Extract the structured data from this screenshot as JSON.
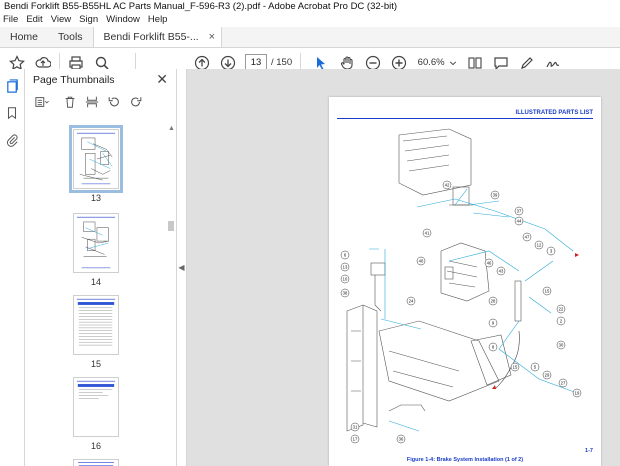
{
  "window": {
    "title": "Bendi Forklift B55-B55HL AC Parts Manual_F-596-R3 (2).pdf - Adobe Acrobat Pro DC (32-bit)"
  },
  "menu": [
    "File",
    "Edit",
    "View",
    "Sign",
    "Window",
    "Help"
  ],
  "tabs": {
    "home": "Home",
    "tools": "Tools",
    "doc": "Bendi Forklift B55-...",
    "close": "×"
  },
  "toolbar": {
    "page_current": "13",
    "page_total": "/ 150",
    "zoom": "60.6%"
  },
  "panel": {
    "title": "Page Thumbnails",
    "close": "✕",
    "thumbnails": [
      {
        "label": "13",
        "selected": true
      },
      {
        "label": "14",
        "selected": false
      },
      {
        "label": "15",
        "selected": false
      },
      {
        "label": "16",
        "selected": false
      }
    ]
  },
  "document": {
    "header": "ILLUSTRATED PARTS LIST",
    "caption": "Figure 1-4:  Brake System Installation (1 of 2)",
    "page_number": "1-7",
    "callouts": [
      "42",
      "39",
      "37",
      "44",
      "41",
      "40",
      "47",
      "12",
      "3",
      "46",
      "43",
      "6",
      "13",
      "10",
      "38",
      "24",
      "15",
      "22",
      "28",
      "2",
      "9",
      "8",
      "30",
      "5",
      "29",
      "27",
      "19",
      "15",
      "31",
      "17",
      "36",
      "23",
      "1",
      "4"
    ]
  },
  "colors": {
    "accent": "#1a3cc8",
    "leader": "#29a9d8"
  }
}
